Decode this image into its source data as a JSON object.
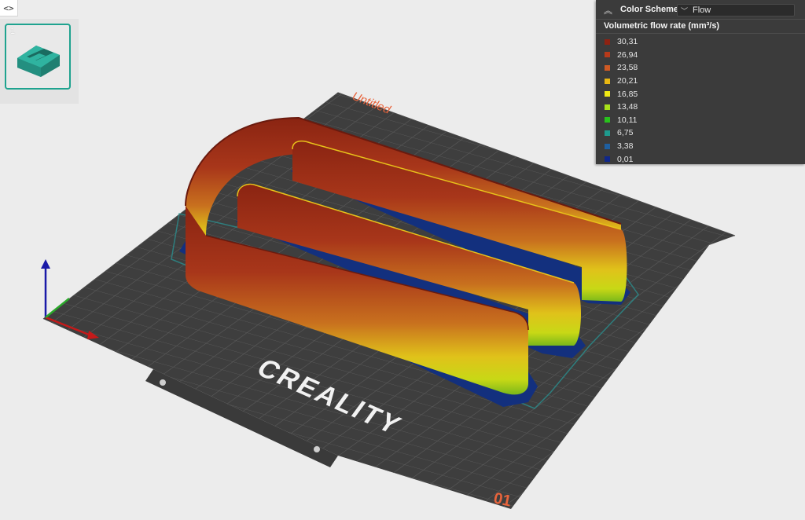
{
  "window": {
    "toggle_label": "<>"
  },
  "plates": [
    {
      "number": "1",
      "thumbnail_color": "#2b9e8c"
    }
  ],
  "bed": {
    "plate_label": "Untitled",
    "brand": "CREALITY",
    "plate_number": "01",
    "colors": {
      "bed": "#3d3d3d",
      "grid": "#5a5a5a",
      "label": "#e8643c"
    }
  },
  "legend": {
    "collapse_icon": "chevron-up-double-icon",
    "title_label": "Color Scheme",
    "selected_scheme": "Flow",
    "subtitle": "Volumetric flow rate (mm³/s)",
    "items": [
      {
        "value": "30,31",
        "color": "#8e2212"
      },
      {
        "value": "26,94",
        "color": "#b83a1a"
      },
      {
        "value": "23,58",
        "color": "#cf5a24"
      },
      {
        "value": "20,21",
        "color": "#e8b712"
      },
      {
        "value": "16,85",
        "color": "#f0ea14"
      },
      {
        "value": "13,48",
        "color": "#a8e21a"
      },
      {
        "value": "10,11",
        "color": "#28c21c"
      },
      {
        "value": "6,75",
        "color": "#1e9a8e"
      },
      {
        "value": "3,38",
        "color": "#1e5fa0"
      },
      {
        "value": "0,01",
        "color": "#10278a"
      }
    ]
  }
}
